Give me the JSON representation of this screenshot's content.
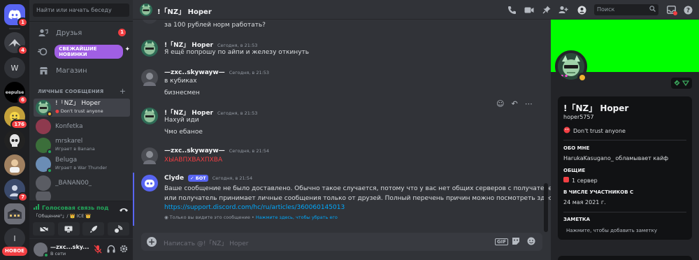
{
  "rail": {
    "servers": [
      {
        "label": "",
        "badge": "1",
        "color": "#5865f2"
      },
      {
        "label": "",
        "badge": "4",
        "color": "#3a3c42"
      },
      {
        "label": "W",
        "badge": "",
        "color": "#313338"
      },
      {
        "label": "eepulse",
        "badge": "6",
        "color": "#000000"
      },
      {
        "label": "",
        "badge": "176",
        "color": "#c4a13b"
      },
      {
        "label": "",
        "badge": "",
        "color": "#222222"
      },
      {
        "label": "",
        "badge": "",
        "color": "#a08060"
      },
      {
        "label": "",
        "badge": "7",
        "color": "#3b4a6b"
      },
      {
        "label": "",
        "badge": "",
        "color": "#6d6f78"
      },
      {
        "label": "I",
        "badge": "",
        "color": "#313338"
      }
    ],
    "new_label": "НОВОЕ"
  },
  "sidebar": {
    "search_placeholder": "Найти или начать беседу",
    "friends_label": "Друзья",
    "friends_badge": "1",
    "nitro_label": "СВЕЖАЙШИЕ НОВИНКИ",
    "shop_label": "Магазин",
    "dm_header": "ЛИЧНЫЕ СООБЩЕНИЯ",
    "dm_add": "+",
    "dms": [
      {
        "name": "!「NZ」 Hoper",
        "sub": "Don't trust anyone",
        "color": "#2e6b55",
        "status": "#f0b232",
        "active": true
      },
      {
        "name": "Konfetka",
        "sub": "",
        "color": "#8e3a4e",
        "status": "",
        "active": false
      },
      {
        "name": "mrskarel",
        "sub": "Играет в Banana",
        "color": "#3b6e3a",
        "status": "#23a55a",
        "active": false
      },
      {
        "name": "Beluga",
        "sub": "Играет в War Thunder",
        "color": "#6b8db5",
        "status": "#23a55a",
        "active": false
      },
      {
        "name": "_BANAN00_",
        "sub": "",
        "color": "#5a5c63",
        "status": "",
        "active": false
      },
      {
        "name": "",
        "sub": "",
        "color": "#5a5c63",
        "status": "",
        "active": false
      }
    ]
  },
  "voice": {
    "title": "Голосовая связь под",
    "subtitle": "「Общение⁵」/ 👑 ICE 👑"
  },
  "user": {
    "name": "—zxc...sky...",
    "status": "В сети"
  },
  "topbar": {
    "title": "!「NZ」 Hoper",
    "search_placeholder": "Поиск"
  },
  "messages": {
    "m0_line": "за 100 рублей норм работать?",
    "m1_name": "!「NZ」 Hoper",
    "m1_time": "Сегодня, в 21:53",
    "m1_line": "Я ещё попрошу по айпи и железу откинуть",
    "m2_name": "—zxc..skywayw—",
    "m2_time": "Сегодня, в 21:53",
    "m2_line1": "в кубиках",
    "m2_line2": "бизнесмен",
    "m3_name": "!「NZ」 Hoper",
    "m3_time": "Сегодня, в 21:53",
    "m3_line1": "Нахуй иди",
    "m3_line2": "Чмо ебаное",
    "m4_name": "—zxc..skywayw—",
    "m4_time": "Сегодня, в 21:54",
    "m4_line": "ХЫАВПХВАХПХВА",
    "m5_name": "Clyde",
    "m5_bot": "✓ БОТ",
    "m5_time": "Сегодня, в 21:54",
    "m5_line1": "Ваше сообщение не было доставлено. Обычно такое случается, потому что у вас нет общих серверов с получателем",
    "m5_line2": "или получатель принимает личные сообщения только от друзей. Полный перечень причин можно посмотреть здесь:",
    "m5_link": "https://support.discord.com/hc/ru/articles/360060145013",
    "eph_text": "Только вы видите это сообщение •",
    "eph_action": "Нажмите здесь, чтобы убрать его"
  },
  "composer": {
    "placeholder": "Написать @!「NZ」 Hoper",
    "gif": "GIF"
  },
  "profile": {
    "name": "!「NZ」 Hoper",
    "username": "hoper5757",
    "custom_status": "Don't trust anyone",
    "about_title": "ОБО МНЕ",
    "about_text": "HarukaKasugano_ обламывает кайф",
    "mutual_title": "ОБЩИЕ",
    "mutual_text": "1 сервер",
    "member_title": "В ЧИСЛЕ УЧАСТНИКОВ С",
    "member_date": "24 мая 2021 г.",
    "note_title": "ЗАМЕТКА",
    "note_placeholder": "Нажмите, чтобы добавить заметку",
    "banner_color": "#00ff00",
    "status_color": "#f0b232"
  }
}
